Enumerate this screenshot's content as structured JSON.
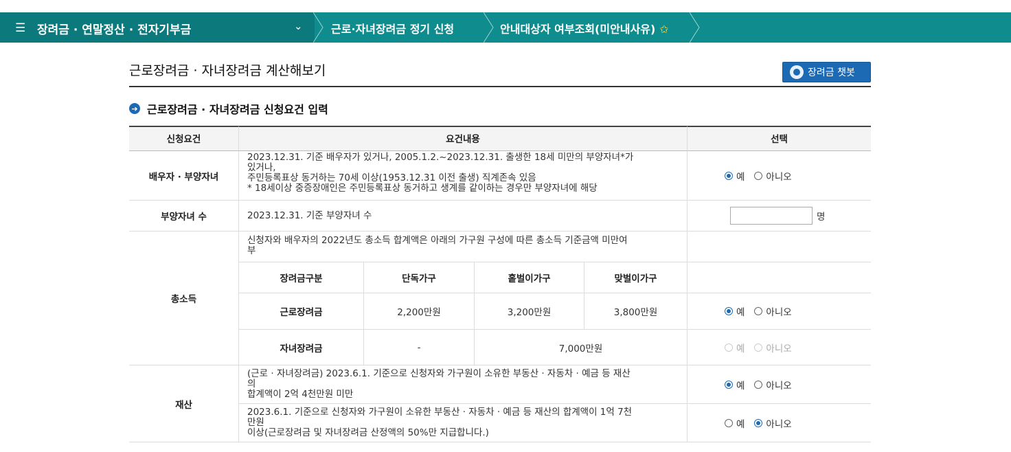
{
  "nav": {
    "menu_title": "장려금 · 연말정산 · 전자기부금",
    "crumb1": "근로·자녀장려금 정기 신청",
    "crumb2": "안내대상자 여부조회(미안내사유)"
  },
  "page": {
    "title": "근로장려금 · 자녀장려금 계산해보기",
    "chatbot_label": "장려금 챗봇",
    "section_title": "근로장려금 · 자녀장려금 신청요건 입력"
  },
  "table": {
    "headers": [
      "신청요건",
      "요건내용",
      "선택"
    ],
    "rows": {
      "spouse": {
        "label": "배우자 · 부양자녀",
        "lines": [
          "2023.12.31. 기준 배우자가 있거나, 2005.1.2.~2023.12.31. 출생한 18세 미만의 부양자녀*가",
          "있거나,",
          "주민등록표상 동거하는 70세 이상(1953.12.31 이전 출생) 직계존속 있음",
          "* 18세이상 중증장애인은 주민등록표상 동거하고 생계를 같이하는 경우만 부양자녀에 해당"
        ],
        "yes": "예",
        "no": "아니오"
      },
      "children": {
        "label": "부양자녀 수",
        "content": "2023.12.31. 기준 부양자녀 수",
        "input_value": "",
        "unit": "명"
      },
      "income": {
        "label": "총소득",
        "desc_lines": [
          "신청자와 배우자의 2022년도 총소득 합계액은 아래의 가구원 구성에 따른 총소득 기준금액 미만여",
          "부"
        ],
        "sub_headers": [
          "장려금구분",
          "단독가구",
          "홑벌이가구",
          "맞벌이가구"
        ],
        "earned_label": "근로장려금",
        "earned_values": [
          "2,200만원",
          "3,200만원",
          "3,800만원"
        ],
        "child_label": "자녀장려금",
        "child_single": "-",
        "child_value": "7,000만원",
        "yes": "예",
        "no": "아니오"
      },
      "property": {
        "label": "재산",
        "a_lines": [
          "(근로 · 자녀장려금) 2023.6.1. 기준으로 신청자와 가구원이 소유한 부동산 · 자동차 · 예금 등 재산",
          "의",
          "합계액이 2억 4천만원 미만"
        ],
        "b_lines": [
          "2023.6.1. 기준으로 신청자와 가구원이 소유한 부동산 · 자동차 · 예금 등 재산의 합계액이 1억 7천",
          "만원",
          "이상(근로장려금 및 자녀장려금 산정액의 50%만 지급합니다.)"
        ],
        "yes": "예",
        "no": "아니오"
      }
    }
  },
  "colors": {
    "nav_bg": "#0f8c8e",
    "nav_dark": "#0c7a7d",
    "accent": "#1d6ab4"
  },
  "icons": [
    "menu-icon",
    "chevron-down-icon",
    "star-icon",
    "chatbot-icon",
    "arrow-bullet-icon"
  ]
}
